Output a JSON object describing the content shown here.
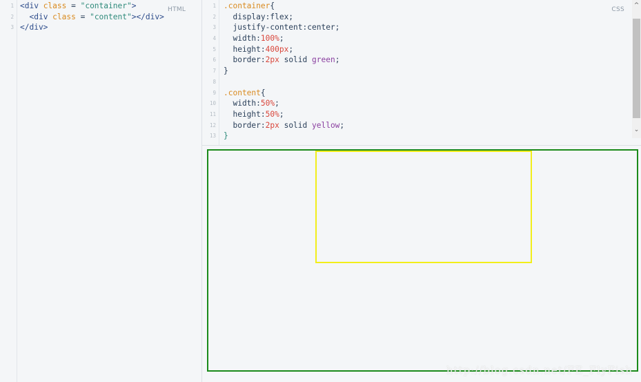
{
  "html_panel": {
    "label": "HTML",
    "lines": [
      {
        "num": "1",
        "parts": [
          [
            "tag",
            "<div "
          ],
          [
            "attr",
            "class"
          ],
          [
            "plain",
            " = "
          ],
          [
            "str",
            "\"container\""
          ],
          [
            "tag",
            ">"
          ]
        ]
      },
      {
        "num": "2",
        "parts": [
          [
            "plain",
            "  "
          ],
          [
            "tag",
            "<div "
          ],
          [
            "attr",
            "class"
          ],
          [
            "plain",
            " = "
          ],
          [
            "str",
            "\"content\""
          ],
          [
            "tag",
            "></div>"
          ]
        ]
      },
      {
        "num": "3",
        "parts": [
          [
            "tag",
            "</div>"
          ]
        ]
      }
    ]
  },
  "css_panel": {
    "label": "CSS",
    "lines": [
      {
        "num": "1",
        "parts": [
          [
            "sel",
            ".container"
          ],
          [
            "plain",
            "{"
          ]
        ]
      },
      {
        "num": "2",
        "parts": [
          [
            "prop",
            "  display:"
          ],
          [
            "plain",
            "flex;"
          ]
        ]
      },
      {
        "num": "3",
        "parts": [
          [
            "prop",
            "  justify-content:"
          ],
          [
            "plain",
            "center;"
          ]
        ]
      },
      {
        "num": "4",
        "parts": [
          [
            "prop",
            "  width:"
          ],
          [
            "num",
            "100%"
          ],
          [
            "plain",
            ";"
          ]
        ]
      },
      {
        "num": "5",
        "parts": [
          [
            "prop",
            "  height:"
          ],
          [
            "num",
            "400px"
          ],
          [
            "plain",
            ";"
          ]
        ]
      },
      {
        "num": "6",
        "parts": [
          [
            "prop",
            "  border:"
          ],
          [
            "num",
            "2px"
          ],
          [
            "plain",
            " solid "
          ],
          [
            "kw",
            "green"
          ],
          [
            "plain",
            ";"
          ]
        ]
      },
      {
        "num": "7",
        "parts": [
          [
            "plain",
            "}"
          ]
        ]
      },
      {
        "num": "8",
        "parts": []
      },
      {
        "num": "9",
        "parts": [
          [
            "sel",
            ".content"
          ],
          [
            "plain",
            "{"
          ]
        ]
      },
      {
        "num": "10",
        "parts": [
          [
            "prop",
            "  width:"
          ],
          [
            "num",
            "50%"
          ],
          [
            "plain",
            ";"
          ]
        ]
      },
      {
        "num": "11",
        "parts": [
          [
            "prop",
            "  height:"
          ],
          [
            "num",
            "50%"
          ],
          [
            "plain",
            ";"
          ]
        ]
      },
      {
        "num": "12",
        "parts": [
          [
            "prop",
            "  border:"
          ],
          [
            "num",
            "2px"
          ],
          [
            "plain",
            " solid "
          ],
          [
            "kw",
            "yellow"
          ],
          [
            "plain",
            ";"
          ]
        ]
      },
      {
        "num": "13",
        "parts": [
          [
            "str",
            "}"
          ]
        ]
      }
    ]
  },
  "preview": {
    "container_border_color": "#1a8a1a",
    "content_border_color": "#f2ee1a"
  },
  "watermark": "http://blog.csdn.net/FE_FlyFish",
  "icons": {
    "scroll_up": "chevron-up-icon",
    "scroll_down": "chevron-down-icon"
  }
}
